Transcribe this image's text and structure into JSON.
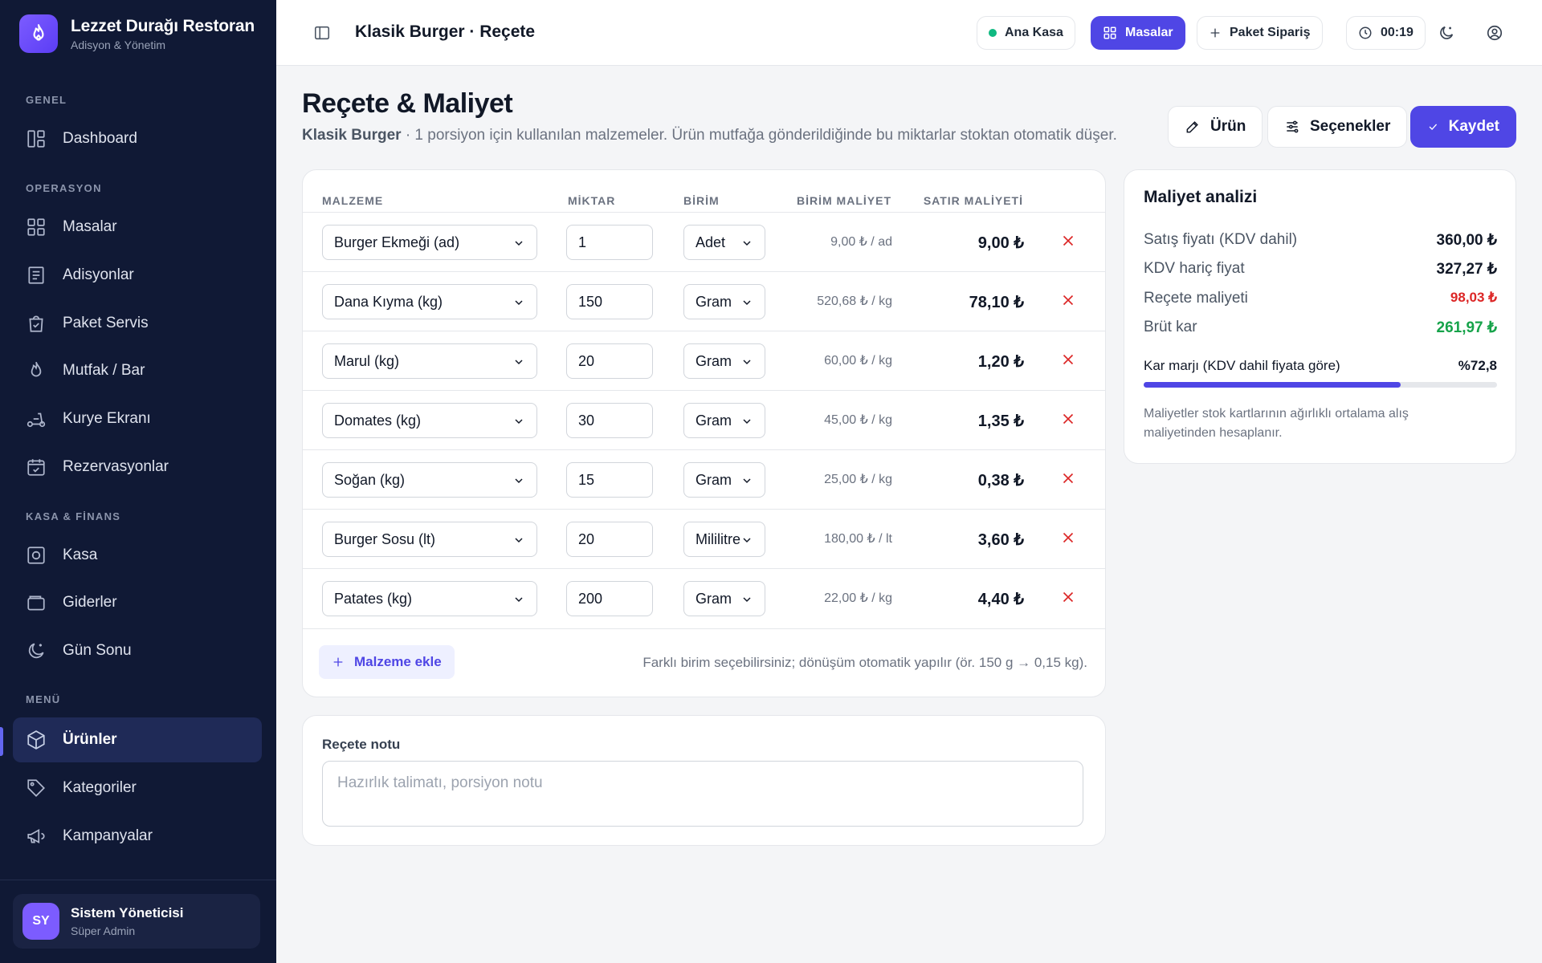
{
  "brand": {
    "name": "Lezzet Durağı Restoran",
    "subtitle": "Adisyon & Yönetim"
  },
  "sidebar": {
    "sections": [
      {
        "label": "GENEL"
      },
      {
        "label": "OPERASYON"
      },
      {
        "label": "KASA & FİNANS"
      },
      {
        "label": "MENÜ"
      }
    ],
    "items": [
      {
        "label": "Dashboard",
        "icon": "dashboard-icon"
      },
      {
        "label": "Masalar",
        "icon": "grid-icon"
      },
      {
        "label": "Adisyonlar",
        "icon": "receipt-icon"
      },
      {
        "label": "Paket Servis",
        "icon": "bag-icon"
      },
      {
        "label": "Mutfak / Bar",
        "icon": "flame-icon"
      },
      {
        "label": "Kurye Ekranı",
        "icon": "scooter-icon"
      },
      {
        "label": "Rezervasyonlar",
        "icon": "calendar-check-icon"
      },
      {
        "label": "Kasa",
        "icon": "safe-icon"
      },
      {
        "label": "Giderler",
        "icon": "wallet-icon"
      },
      {
        "label": "Gün Sonu",
        "icon": "moon-icon"
      },
      {
        "label": "Ürünler",
        "icon": "box-icon",
        "active": true
      },
      {
        "label": "Kategoriler",
        "icon": "tag-icon"
      },
      {
        "label": "Kampanyalar",
        "icon": "megaphone-icon"
      }
    ],
    "user": {
      "initials": "SY",
      "name": "Sistem Yöneticisi",
      "role": "Süper Admin"
    }
  },
  "topbar": {
    "title": "Klasik Burger · Reçete",
    "register_label": "Ana Kasa",
    "tables_label": "Masalar",
    "takeaway_label": "Paket Sipariş",
    "clock": "00:19"
  },
  "page": {
    "title": "Reçete & Maliyet",
    "product_name": "Klasik Burger",
    "description": " · 1 porsiyon için kullanılan malzemeler. Ürün mutfağa gönderildiğinde bu miktarlar stoktan otomatik düşer.",
    "btn_product": "Ürün",
    "btn_options": "Seçenekler",
    "btn_save": "Kaydet"
  },
  "recipe": {
    "headers": {
      "ingredient": "MALZEME",
      "quantity": "MİKTAR",
      "unit": "BİRİM",
      "unit_cost": "BİRİM MALİYET",
      "line_cost": "SATIR MALİYETİ"
    },
    "rows": [
      {
        "ingredient": "Burger Ekmeği (ad)",
        "quantity": "1",
        "unit": "Adet",
        "unit_cost": "9,00 ₺ / ad",
        "line_cost": "9,00 ₺"
      },
      {
        "ingredient": "Dana Kıyma (kg)",
        "quantity": "150",
        "unit": "Gram",
        "unit_cost": "520,68 ₺ / kg",
        "line_cost": "78,10 ₺"
      },
      {
        "ingredient": "Marul (kg)",
        "quantity": "20",
        "unit": "Gram",
        "unit_cost": "60,00 ₺ / kg",
        "line_cost": "1,20 ₺"
      },
      {
        "ingredient": "Domates (kg)",
        "quantity": "30",
        "unit": "Gram",
        "unit_cost": "45,00 ₺ / kg",
        "line_cost": "1,35 ₺"
      },
      {
        "ingredient": "Soğan (kg)",
        "quantity": "15",
        "unit": "Gram",
        "unit_cost": "25,00 ₺ / kg",
        "line_cost": "0,38 ₺"
      },
      {
        "ingredient": "Burger Sosu (lt)",
        "quantity": "20",
        "unit": "Mililitre",
        "unit_cost": "180,00 ₺ / lt",
        "line_cost": "3,60 ₺"
      },
      {
        "ingredient": "Patates (kg)",
        "quantity": "200",
        "unit": "Gram",
        "unit_cost": "22,00 ₺ / kg",
        "line_cost": "4,40 ₺"
      }
    ],
    "add_label": "Malzeme ekle",
    "hint": "Farklı birim seçebilirsiniz; dönüşüm otomatik yapılır (ör. 150 g → 0,15 kg)."
  },
  "note": {
    "label": "Reçete notu",
    "placeholder": "Hazırlık talimatı, porsiyon notu"
  },
  "analysis": {
    "title": "Maliyet analizi",
    "sale_price_label": "Satış fiyatı (KDV dahil)",
    "sale_price": "360,00 ₺",
    "net_price_label": "KDV hariç fiyat",
    "net_price": "327,27 ₺",
    "recipe_cost_label": "Reçete maliyeti",
    "recipe_cost": "98,03 ₺",
    "gross_profit_label": "Brüt kar",
    "gross_profit": "261,97 ₺",
    "margin_label": "Kar marjı (KDV dahil fiyata göre)",
    "margin": "%72,8",
    "margin_value": 72.8,
    "footnote": "Maliyetler stok kartlarının ağırlıklı ortalama alış maliyetinden hesaplanır."
  },
  "colors": {
    "accent": "#4f46e5",
    "sidebar_bg": "#101935",
    "danger": "#dc2626",
    "success": "#16a34a"
  }
}
